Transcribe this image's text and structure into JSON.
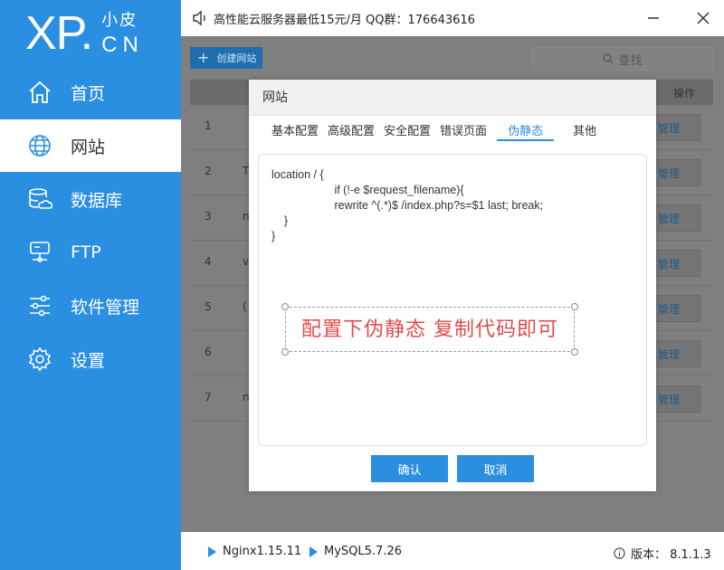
{
  "logo": {
    "brand": "XP.",
    "cn_top": "小皮",
    "cn_bottom": "CN"
  },
  "sidebar": {
    "items": [
      {
        "label": "首页",
        "icon": "home-icon"
      },
      {
        "label": "网站",
        "icon": "globe-icon",
        "active": true
      },
      {
        "label": "数据库",
        "icon": "database-icon"
      },
      {
        "label": "FTP",
        "icon": "server-icon"
      },
      {
        "label": "软件管理",
        "icon": "sliders-icon"
      },
      {
        "label": "设置",
        "icon": "gear-icon"
      }
    ]
  },
  "topbar": {
    "notice": "高性能云服务器最低15元/月  QQ群：176643616"
  },
  "toolbar": {
    "create_label": "创建网站",
    "search_label": "查找"
  },
  "table": {
    "op_header": "操作",
    "rows": [
      {
        "num": "1",
        "frag": "",
        "action": "管理"
      },
      {
        "num": "2",
        "frag": "T",
        "action": "管理"
      },
      {
        "num": "3",
        "frag": "n",
        "action": "管理"
      },
      {
        "num": "4",
        "frag": "v",
        "action": "管理"
      },
      {
        "num": "5",
        "frag": "(",
        "action": "管理"
      },
      {
        "num": "6",
        "frag": "",
        "action": "管理"
      },
      {
        "num": "7",
        "frag": "n",
        "action": "管理"
      }
    ]
  },
  "modal": {
    "title": "网站",
    "tabs": [
      "基本配置",
      "高级配置",
      "安全配置",
      "错误页面",
      "伪静态",
      "其他"
    ],
    "active_tab": "伪静态",
    "code": "location / {\n                    if (!-e $request_filename){\n                    rewrite ^(.*)$ /index.php?s=$1 last; break;\n    }\n}",
    "annotation": "配置下伪静态  复制代码即可",
    "confirm_label": "确认",
    "cancel_label": "取消"
  },
  "status": {
    "nginx": "Nginx1.15.11",
    "mysql": "MySQL5.7.26",
    "version": "版本： 8.1.1.3"
  },
  "colors": {
    "accent": "#2a8fe0",
    "annotation": "#e44a4a",
    "overlay": "#7f7f7f"
  }
}
